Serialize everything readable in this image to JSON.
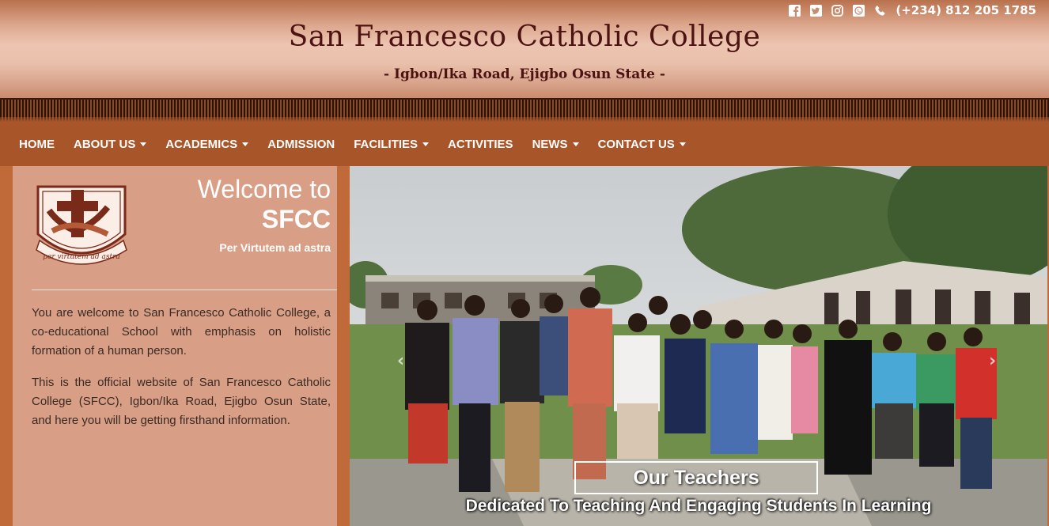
{
  "header": {
    "title": "San Francesco Catholic College",
    "address": "- Igbon/Ika Road, Ejigbo Osun State -",
    "phone": "(+234) 812 205 1785",
    "social_icons": [
      "facebook-icon",
      "twitter-icon",
      "instagram-icon",
      "whatsapp-icon",
      "phone-icon"
    ]
  },
  "nav": {
    "items": [
      {
        "label": "HOME",
        "dropdown": false
      },
      {
        "label": "ABOUT US",
        "dropdown": true
      },
      {
        "label": "ACADEMICS",
        "dropdown": true
      },
      {
        "label": "ADMISSION",
        "dropdown": false
      },
      {
        "label": "FACILITIES",
        "dropdown": true
      },
      {
        "label": "ACTIVITIES",
        "dropdown": false
      },
      {
        "label": "NEWS",
        "dropdown": true
      },
      {
        "label": "CONTACT US",
        "dropdown": true
      }
    ]
  },
  "welcome": {
    "line1": "Welcome to",
    "line2": "SFCC",
    "motto": "Per Virtutem ad astra",
    "logo_text": "per virtutem ad astra",
    "paragraph1": "You are welcome to San Francesco Catholic College, a co-educational School with emphasis on holistic formation of a human person.",
    "paragraph2": "This is the official website of San Francesco Catholic College (SFCC), Igbon/Ika Road, Ejigbo Osun State, and here you will be getting firsthand information."
  },
  "carousel": {
    "caption_title": "Our Teachers",
    "caption_subtitle": "Dedicated To Teaching And Engaging Students In Learning"
  },
  "colors": {
    "header_text": "#4d1212",
    "nav_bg": "#a8552a",
    "panel_bg": "#d89f86",
    "page_bg": "#c06a3a"
  }
}
